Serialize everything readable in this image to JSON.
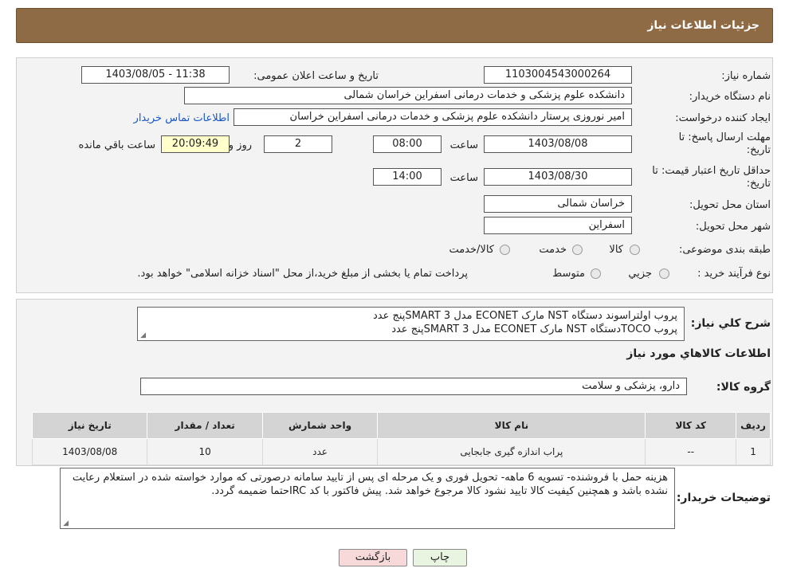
{
  "page": {
    "title": "جزئیات اطلاعات نیاز"
  },
  "fields": {
    "need_number": {
      "label": "شماره نیاز:",
      "value": "1103004543000264"
    },
    "announce_datetime": {
      "label": "تاریخ و ساعت اعلان عمومی:",
      "value": "1403/08/05 - 11:38"
    },
    "buyer_org": {
      "label": "نام دستگاه خریدار:",
      "value": "دانشکده علوم پزشکی و خدمات درمانی اسفراین خراسان شمالی"
    },
    "creator": {
      "label": "ایجاد کننده درخواست:",
      "value": "امیر  نوروزی  پرستار  دانشکده علوم پزشکی و خدمات درمانی اسفراین خراسان",
      "link": "اطلاعات تماس خریدار"
    },
    "reply_deadline": {
      "label": "مهلت ارسال پاسخ: تا تاریخ:",
      "date": "1403/08/08",
      "time_label": "ساعت",
      "time": "08:00",
      "days": "2",
      "days_label": "روز و",
      "remaining": "20:09:49",
      "remaining_label": "ساعت باقي مانده"
    },
    "price_validity": {
      "label": "حداقل تاریخ اعتبار قیمت: تا تاریخ:",
      "date": "1403/08/30",
      "time_label": "ساعت",
      "time": "14:00"
    },
    "province": {
      "label": "استان محل تحویل:",
      "value": "خراسان شمالی"
    },
    "city": {
      "label": "شهر محل تحویل:",
      "value": "اسفراین"
    },
    "category": {
      "label": "طبقه بندی موضوعی:",
      "options": [
        "کالا",
        "خدمت",
        "کالا/خدمت"
      ]
    },
    "purchase_type": {
      "label": "نوع فرآیند خرید :",
      "options": [
        "جزيي",
        "متوسط"
      ],
      "note": "پرداخت تمام یا بخشی از مبلغ خرید،از محل \"اسناد خزانه اسلامی\" خواهد بود."
    }
  },
  "description": {
    "label": "شرح کلي نياز:",
    "line1": "پروب اولتراسوند دستگاه NST مارک ECONET مدل SMART 3پنج عدد",
    "line2": "پروب TOCOدستگاه NST مارک ECONET مدل SMART 3پنج عدد"
  },
  "goods_info_title": "اطلاعات کالاهاي مورد نياز",
  "goods_group": {
    "label": "گروه کالا:",
    "value": "دارو، پزشکی و سلامت"
  },
  "table": {
    "headers": [
      "رديف",
      "کد کالا",
      "نام کالا",
      "واحد شمارش",
      "تعداد / مقدار",
      "تاریخ نیاز"
    ],
    "rows": [
      [
        "1",
        "--",
        "پراب اندازه گیری جابجایی",
        "عدد",
        "10",
        "1403/08/08"
      ]
    ]
  },
  "buyer_notes": {
    "label": "توضیحات خریدار:",
    "text": "هزینه حمل با فروشنده- تسویه 6 ماهه- تحویل فوری و یک مرحله ای پس از تایید سامانه درصورتی که موارد خواسته شده در استعلام رعایت نشده باشد و همچنین کیفیت کالا تایید نشود کالا مرجوع خواهد شد. پیش فاکتور با کد IRCحتما ضمیمه گردد."
  },
  "buttons": {
    "print": "چاپ",
    "back": "بازگشت"
  },
  "colors": {
    "header": "#8e6a45",
    "link": "#1a56c8",
    "back_button": "#f7d9d9",
    "print_button": "#e9f5e1",
    "remaining_box": "#ffffcc"
  }
}
